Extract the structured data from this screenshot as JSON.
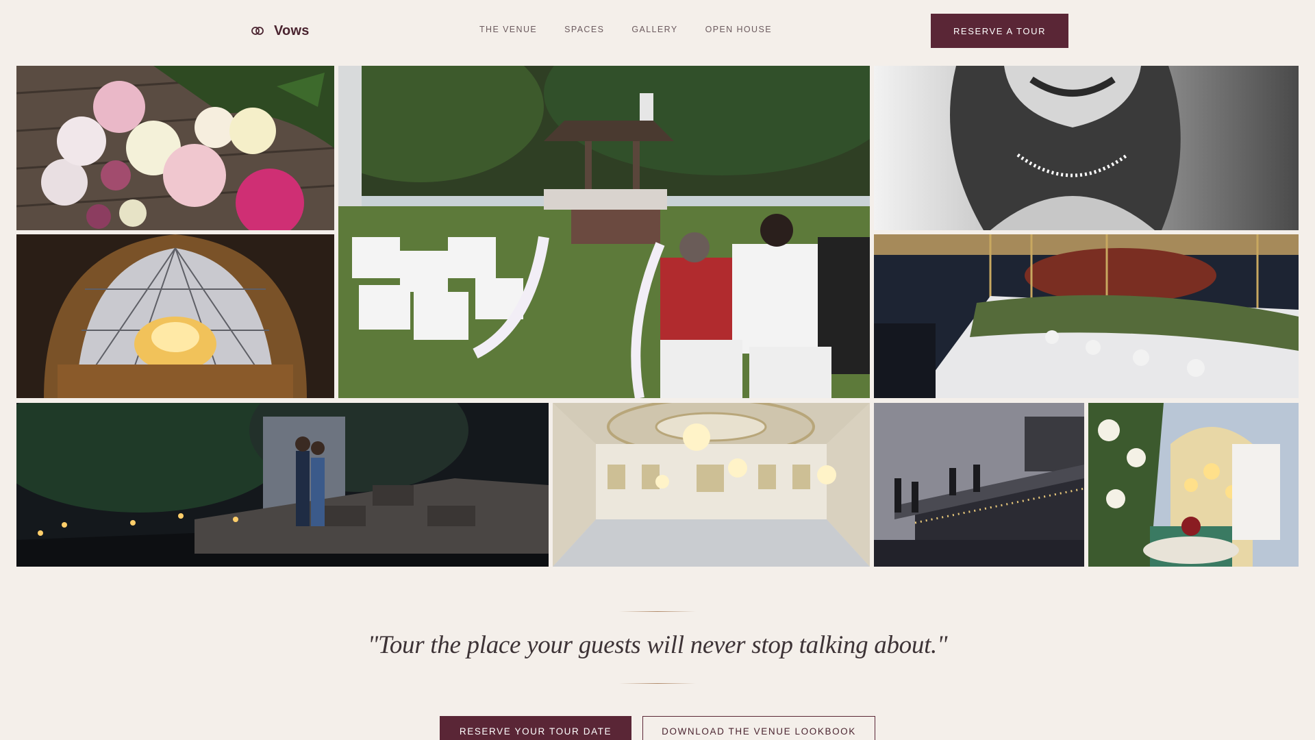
{
  "brand": {
    "name": "Vows",
    "icon": "rings-icon"
  },
  "nav": {
    "links": [
      "THE VENUE",
      "SPACES",
      "GALLERY",
      "OPEN HOUSE"
    ],
    "cta_label": "RESERVE A TOUR"
  },
  "gallery": {
    "photos": [
      "peony-bouquet-photo",
      "garden-gazebo-ceremony-photo",
      "smiling-woman-pearls-photo",
      "glass-dome-chandelier-photo",
      "long-banquet-table-photo",
      "couple-stone-steps-photo",
      "grand-ballroom-photo",
      "rooftop-terrace-dusk-photo",
      "floral-wedding-arch-photo"
    ]
  },
  "quote": {
    "text": "\"Tour the place your guests will never stop talking about.\""
  },
  "cta": {
    "primary_label": "RESERVE YOUR TOUR DATE",
    "secondary_label": "DOWNLOAD THE VENUE LOOKBOOK"
  },
  "colors": {
    "background": "#f4efea",
    "brand_plum": "#5a2636",
    "accent_gold": "#b08968"
  }
}
